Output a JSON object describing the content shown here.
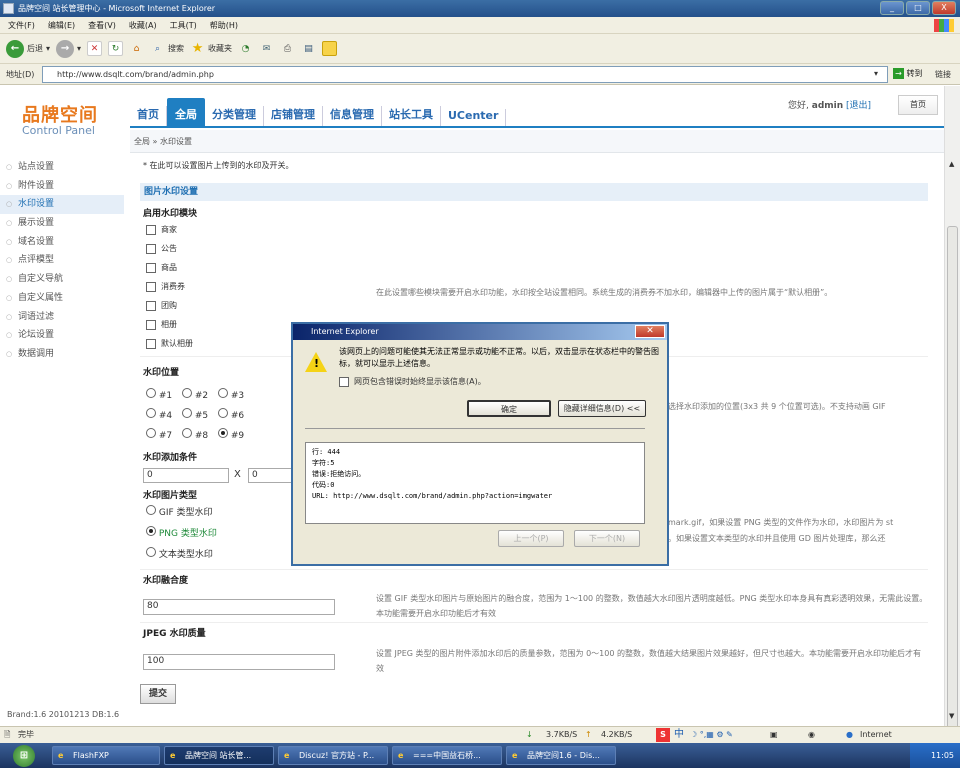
{
  "window": {
    "title": "品牌空间 站长管理中心 - Microsoft Internet Explorer",
    "controls": [
      "_",
      "□",
      "X"
    ]
  },
  "menubar": [
    "文件(F)",
    "编辑(E)",
    "查看(V)",
    "收藏(A)",
    "工具(T)",
    "帮助(H)"
  ],
  "toolbar": {
    "back": "后退",
    "search": "搜索",
    "favorites": "收藏夹"
  },
  "address": {
    "label": "地址(D)",
    "url": "http://www.dsqlt.com/brand/admin.php",
    "go": "转到",
    "links": "链接"
  },
  "header": {
    "logo": "品牌空间",
    "logo_sub": "Control Panel",
    "nav": [
      "首页",
      "全局",
      "分类管理",
      "店铺管理",
      "信息管理",
      "站长工具",
      "UCenter"
    ],
    "user_prefix": "您好,",
    "username": "admin",
    "logout": "[退出]",
    "home": "首页",
    "breadcrumb": "全局 » 水印设置"
  },
  "sidebar": {
    "items": [
      "站点设置",
      "附件设置",
      "水印设置",
      "展示设置",
      "域名设置",
      "点评模型",
      "自定义导航",
      "自定义属性",
      "词语过滤",
      "论坛设置",
      "数据调用"
    ],
    "active_index": 2,
    "version": "Brand:1.6 20101213 DB:1.6"
  },
  "main": {
    "tip": "* 在此可以设置图片上传到的水印及开关。",
    "section_title": "图片水印设置",
    "module_label": "启用水印模块",
    "modules": [
      "商家",
      "公告",
      "商品",
      "消费券",
      "团购",
      "相册",
      "默认相册"
    ],
    "module_desc": "在此设置哪些模块需要开启水印功能，水印按全站设置相同。系统生成的消费券不加水印，编辑器中上传的图片属于“默认相册”。",
    "position_label": "水印位置",
    "positions": [
      "#1",
      "#2",
      "#3",
      "#4",
      "#5",
      "#6",
      "#7",
      "#8",
      "#9"
    ],
    "position_selected": "#9",
    "position_desc": "选择水印添加的位置(3x3 共 9 个位置可选)。不支持动画 GIF",
    "condition_label": "水印添加条件",
    "condition_w": "0",
    "condition_x": "X",
    "condition_h": "0",
    "type_label": "水印图片类型",
    "types": [
      "GIF 类型水印",
      "PNG 类型水印",
      "文本类型水印"
    ],
    "type_selected": "PNG 类型水印",
    "type_desc1": "mark.gif，如果设置 PNG 类型的文件作为水印，水印图片为 st",
    "type_desc2": "。如果设置文本类型的水印并且使用 GD 图片处理库，那么还",
    "trans_label": "水印融合度",
    "trans_value": "80",
    "trans_desc": "设置 GIF 类型水印图片与原始图片的融合度，范围为 1～100 的整数，数值越大水印图片透明度越低。PNG 类型水印本身具有真彩透明效果，无需此设置。本功能需要开启水印功能后才有效",
    "jpeg_label": "JPEG 水印质量",
    "jpeg_value": "100",
    "jpeg_desc": "设置 JPEG 类型的图片附件添加水印后的质量参数，范围为 0～100 的整数，数值越大结果图片效果越好，但尺寸也越大。本功能需要开启水印功能后才有效",
    "submit": "提交"
  },
  "dialog": {
    "title": "Internet Explorer",
    "message": "该网页上的问题可能使其无法正常显示或功能不正常。以后，双击显示在状态栏中的警告图标，就可以显示上述信息。",
    "checkbox": "网页包含错误时始终显示该信息(A)。",
    "ok": "确定",
    "hide_details": "隐藏详细信息(D) <<",
    "detail_lines": [
      "行:  444",
      "字符:5",
      "错误:拒绝访问。",
      "代码:0",
      "URL:  http://www.dsqlt.com/brand/admin.php?action=imgwater"
    ],
    "prev": "上一个(P)",
    "next": "下一个(N)"
  },
  "statusbar": {
    "text": "完毕",
    "down": "3.7KB/S",
    "up": "4.2KB/S",
    "ime": "中",
    "zone": "Internet"
  },
  "taskbar": {
    "tasks": [
      "FlashFXP",
      "品牌空间 站长管...",
      "Discuz! 官方站 - P...",
      "===中国益石桥...",
      "品牌空间1.6 - Dis..."
    ],
    "time": "11:05"
  }
}
